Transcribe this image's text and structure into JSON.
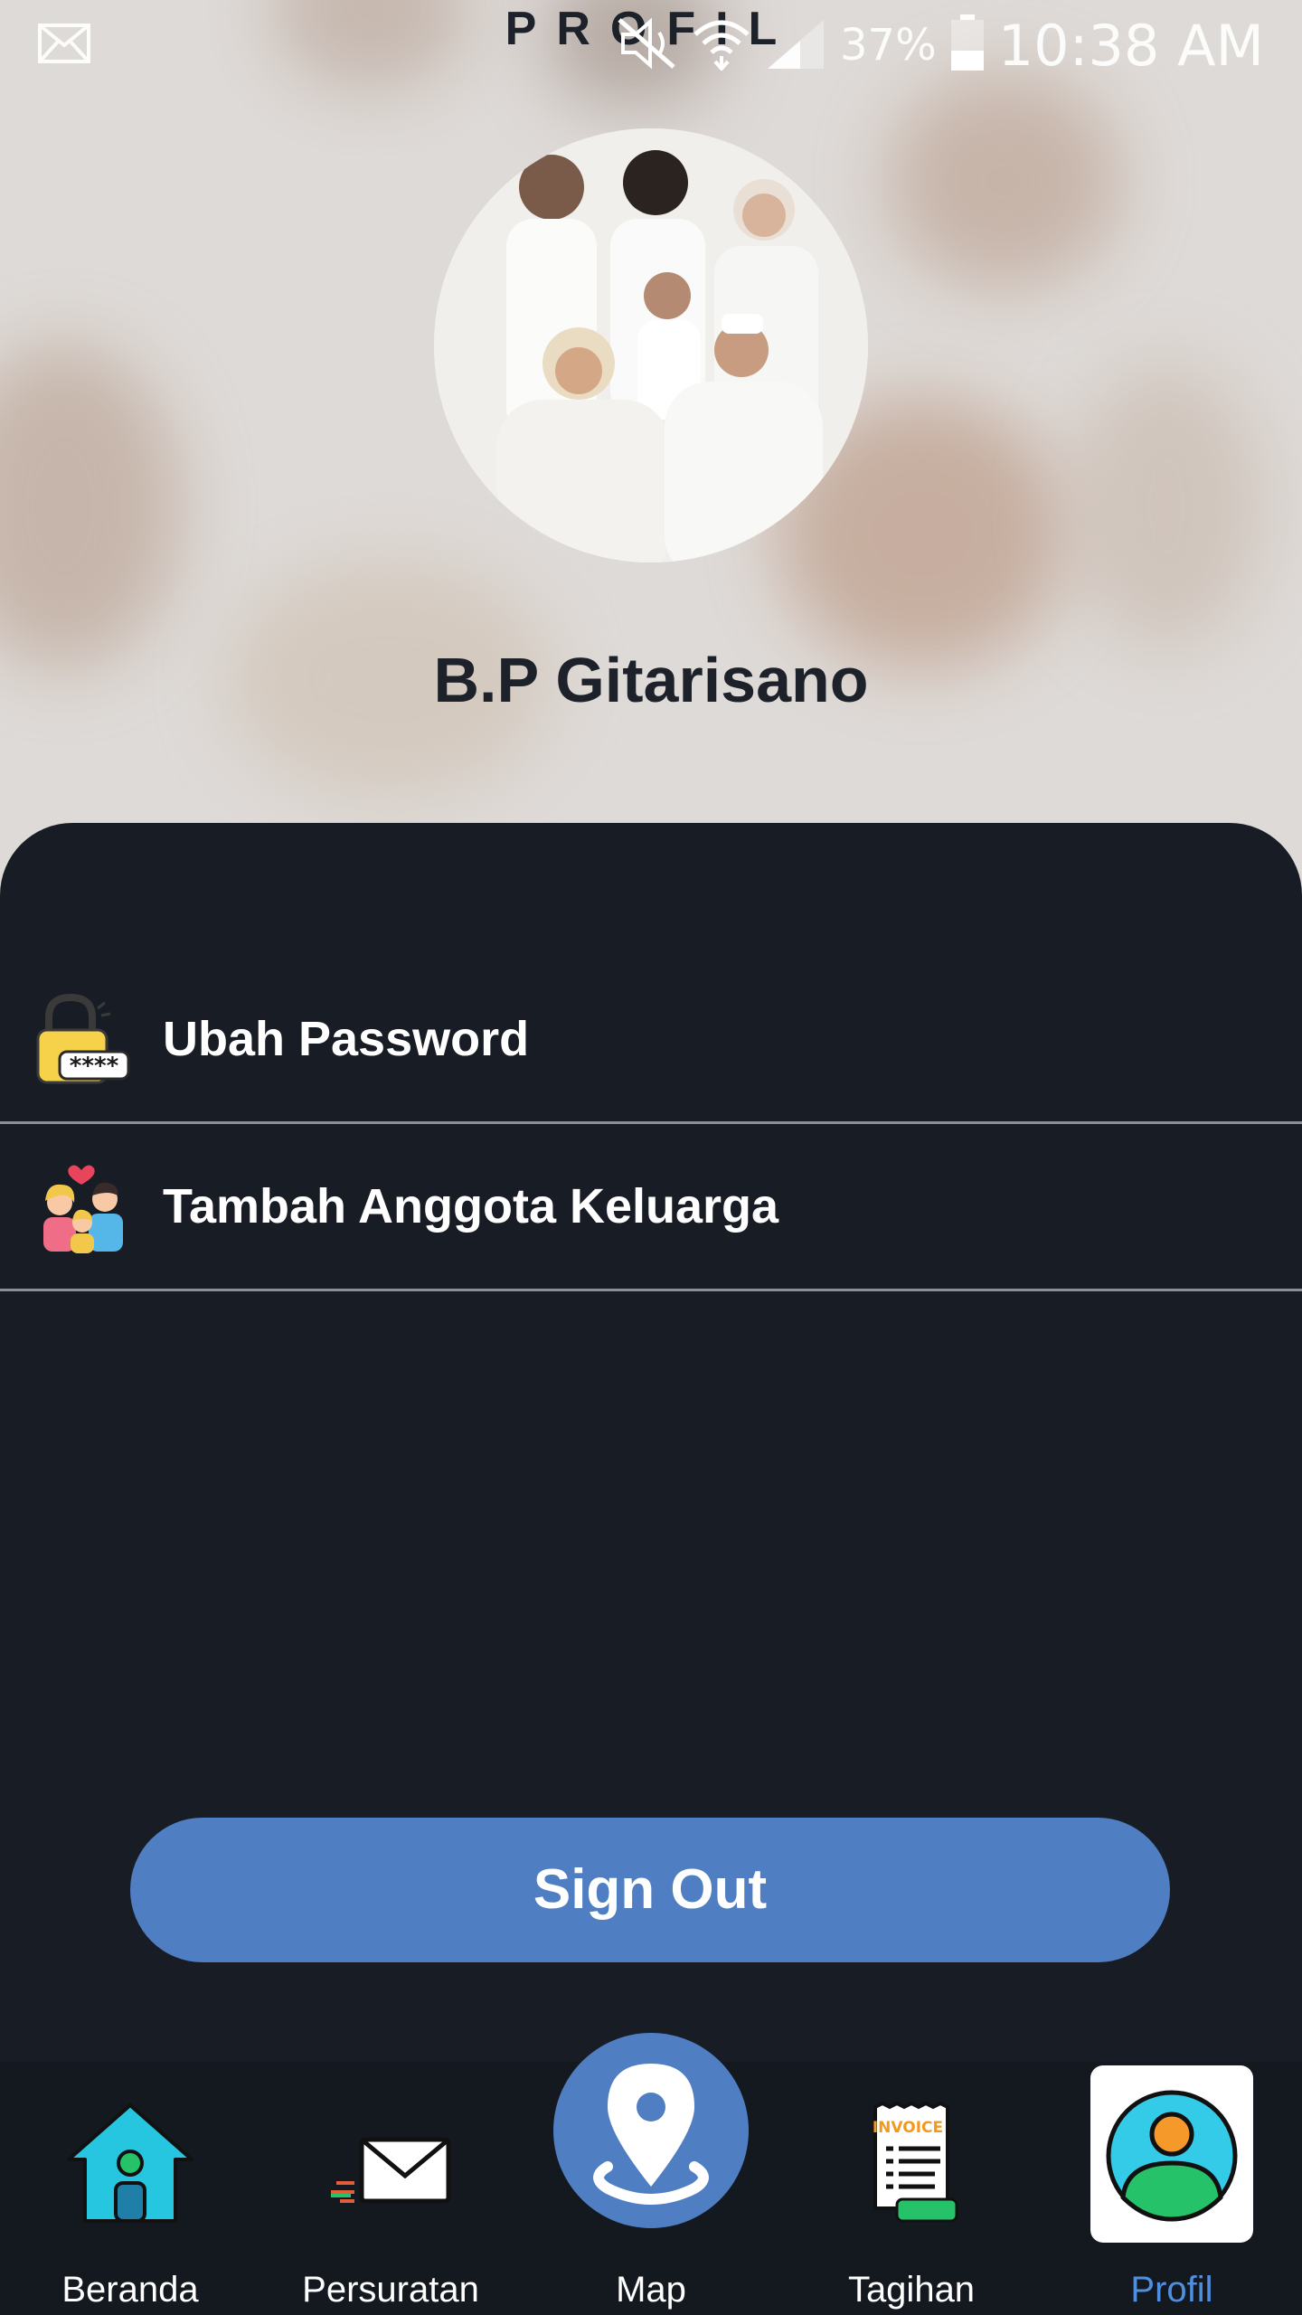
{
  "status_bar": {
    "battery_percent": "37%",
    "time": "10:38 AM"
  },
  "header": {
    "title": "PROFIL"
  },
  "profile": {
    "name": "B.P Gitarisano"
  },
  "menu": {
    "items": [
      {
        "label": "Ubah Password",
        "icon": "lock-password-icon"
      },
      {
        "label": "Tambah Anggota Keluarga",
        "icon": "family-icon"
      }
    ]
  },
  "actions": {
    "sign_out_label": "Sign Out"
  },
  "bottom_nav": {
    "items": [
      {
        "label": "Beranda",
        "icon": "home-icon"
      },
      {
        "label": "Persuratan",
        "icon": "mail-icon"
      },
      {
        "label": "Map",
        "icon": "map-pin-icon"
      },
      {
        "label": "Tagihan",
        "icon": "invoice-icon",
        "badge": "INVOICE"
      },
      {
        "label": "Profil",
        "icon": "profile-icon",
        "active": true
      }
    ]
  },
  "colors": {
    "sheet": "#181d25",
    "accent": "#4f7ec3",
    "active_nav": "#4f8fe0"
  }
}
